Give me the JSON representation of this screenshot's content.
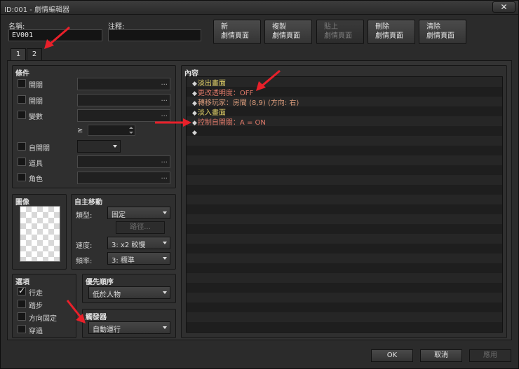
{
  "window": {
    "title": "ID:001 - 劇情編輯器",
    "close_glyph": "✕"
  },
  "header": {
    "name_label": "名稱:",
    "name_value": "EV001",
    "note_label": "注釋:",
    "note_value": ""
  },
  "toolbar": {
    "new_page": [
      "新",
      "劇情頁面"
    ],
    "copy_page": [
      "複製",
      "劇情頁面"
    ],
    "paste_page": [
      "貼上",
      "劇情頁面"
    ],
    "delete_page": [
      "刪除",
      "劇情頁面"
    ],
    "clear_page": [
      "清除",
      "劇情頁面"
    ]
  },
  "tabs": [
    "1",
    "2"
  ],
  "conditions": {
    "title": "條件",
    "switch1_label": "開關",
    "switch2_label": "開關",
    "variable_label": "變數",
    "gte_symbol": "≥",
    "self_switch_label": "自開關",
    "item_label": "道具",
    "actor_label": "角色",
    "dots": "..."
  },
  "image": {
    "title": "圖像"
  },
  "autonomous": {
    "title": "自主移動",
    "type_label": "類型:",
    "type_value": "固定",
    "route_button": "路徑...",
    "speed_label": "速度:",
    "speed_value": "3: x2 較慢",
    "freq_label": "頻率:",
    "freq_value": "3: 標準"
  },
  "options": {
    "title": "選項",
    "walk": "行走",
    "step": "踏步",
    "dir_fix": "方向固定",
    "through": "穿過",
    "walk_checked": true
  },
  "priority": {
    "title": "優先順序",
    "value": "低於人物"
  },
  "trigger": {
    "title": "觸發器",
    "value": "自動運行"
  },
  "contents": {
    "title": "內容",
    "diamond": "◆",
    "commands": [
      {
        "text": "淡出畫面",
        "color": "#e8d66a"
      },
      {
        "text": "更改透明度：OFF",
        "color": "#e07a6a"
      },
      {
        "text": "轉移玩家：房間 (8,9) (方向: 右)",
        "color": "#d89a7a"
      },
      {
        "text": "淡入畫面",
        "color": "#e8d66a"
      },
      {
        "text": "控制自開關：A = ON",
        "color": "#e07a6a"
      },
      {
        "text": "",
        "color": "#d4d4d4"
      }
    ]
  },
  "footer": {
    "ok": "OK",
    "cancel": "取消",
    "apply": "應用"
  },
  "colors": {
    "annotation_arrow": "#e8202a"
  }
}
